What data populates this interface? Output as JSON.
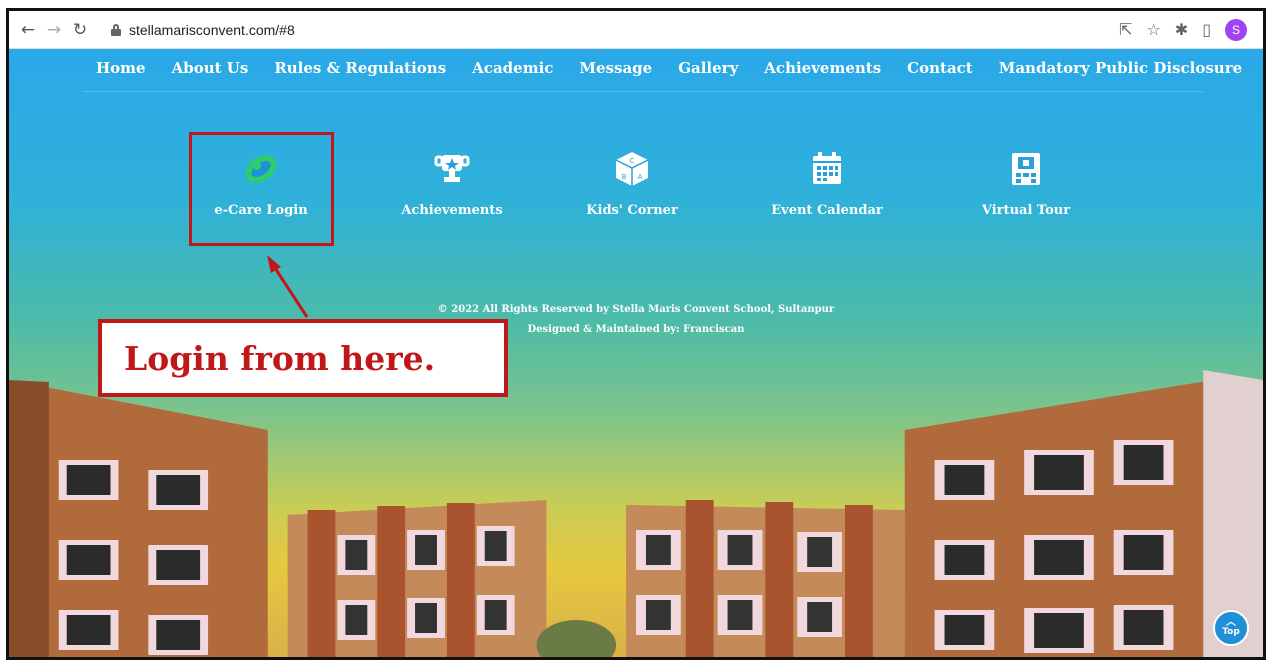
{
  "browser": {
    "url": "stellamarisconvent.com/#8",
    "avatar_letter": "S"
  },
  "nav": {
    "items": [
      "Home",
      "About Us",
      "Rules & Regulations",
      "Academic",
      "Message",
      "Gallery",
      "Achievements",
      "Contact",
      "Mandatory Public Disclosure"
    ]
  },
  "quick_links": [
    {
      "label": "e-Care Login",
      "icon": "globe-icon"
    },
    {
      "label": "Achievements",
      "icon": "trophy-icon"
    },
    {
      "label": "Kids' Corner",
      "icon": "abc-block-icon"
    },
    {
      "label": "Event Calendar",
      "icon": "calendar-icon"
    },
    {
      "label": "Virtual Tour",
      "icon": "floppy-building-icon"
    }
  ],
  "footer": {
    "copyright": "© 2022 All Rights Reserved by Stella Maris Convent School, Sultanpur",
    "designed": "Designed & Maintained by: Franciscan"
  },
  "annotation": {
    "callout_text": "Login from here."
  },
  "top_button": {
    "label": "Top"
  },
  "colors": {
    "annotation_red": "#c01818",
    "sky_top": "#2aa8e8",
    "sky_bottom": "#e6c83e",
    "building_brick": "#a9542f",
    "building_tan": "#c9965a"
  }
}
